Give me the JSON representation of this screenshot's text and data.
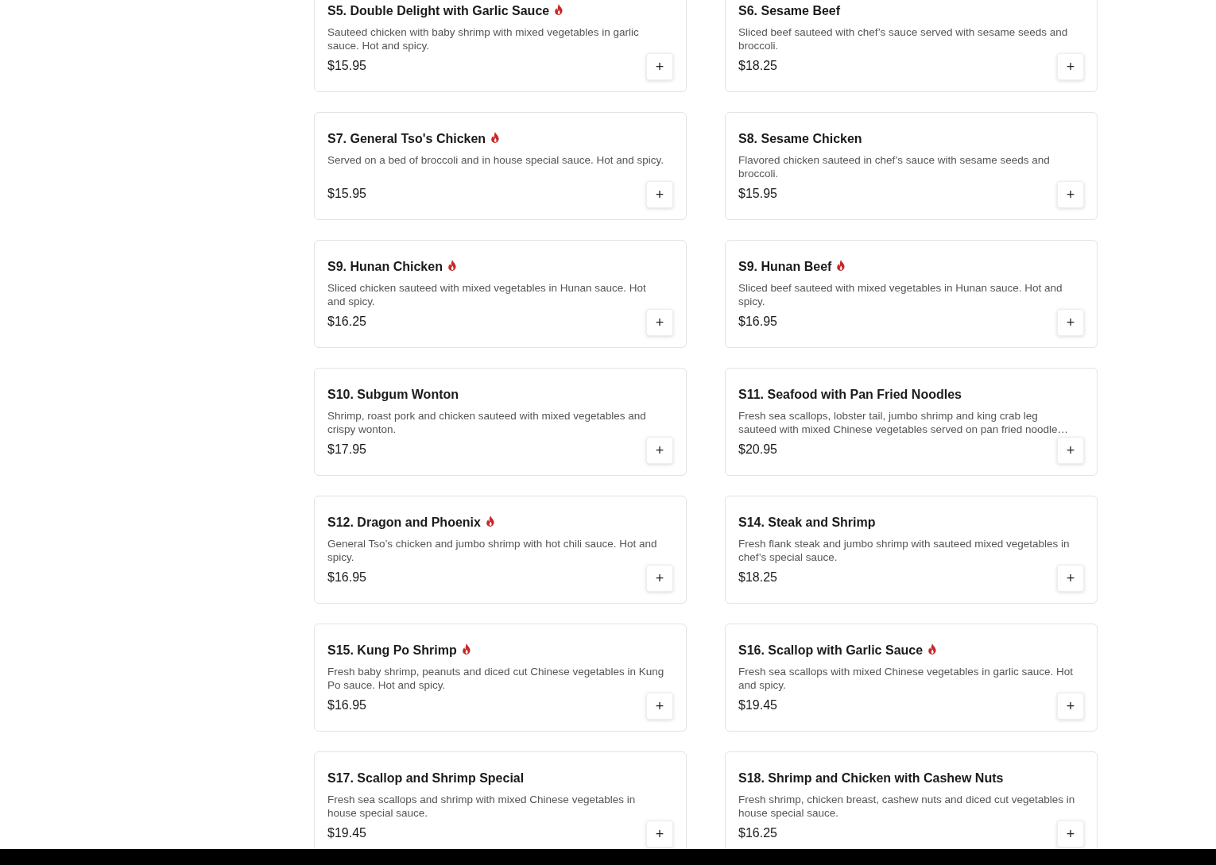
{
  "menu_items": [
    {
      "name": "S5. Double Delight with Garlic Sauce",
      "spicy": true,
      "description": "Sauteed chicken with baby shrimp with mixed vegetables in garlic sauce. Hot and spicy.",
      "price": "$15.95",
      "add_button": "+"
    },
    {
      "name": "S6. Sesame Beef",
      "spicy": false,
      "description": "Sliced beef sauteed with chef’s sauce served with sesame seeds and broccoli.",
      "price": "$18.25",
      "add_button": "+"
    },
    {
      "name": "S7. General Tso's Chicken",
      "spicy": true,
      "description": "Served on a bed of broccoli and in house special sauce. Hot and spicy.",
      "price": "$15.95",
      "add_button": "+"
    },
    {
      "name": "S8. Sesame Chicken",
      "spicy": false,
      "description": "Flavored chicken sauteed in chef’s sauce with sesame seeds and broccoli.",
      "price": "$15.95",
      "add_button": "+"
    },
    {
      "name": "S9. Hunan Chicken",
      "spicy": true,
      "description": "Sliced chicken sauteed with mixed vegetables in Hunan sauce. Hot and spicy.",
      "price": "$16.25",
      "add_button": "+"
    },
    {
      "name": "S9. Hunan Beef",
      "spicy": true,
      "description": "Sliced beef sauteed with mixed vegetables in Hunan sauce. Hot and spicy.",
      "price": "$16.95",
      "add_button": "+"
    },
    {
      "name": "S10. Subgum Wonton",
      "spicy": false,
      "description": "Shrimp, roast pork and chicken sauteed with mixed vegetables and crispy wonton.",
      "price": "$17.95",
      "add_button": "+"
    },
    {
      "name": "S11. Seafood with Pan Fried Noodles",
      "spicy": false,
      "description": "Fresh sea scallops, lobster tail, jumbo shrimp and king crab leg sauteed with mixed Chinese vegetables served on pan fried noodle…",
      "price": "$20.95",
      "add_button": "+"
    },
    {
      "name": "S12. Dragon and Phoenix",
      "spicy": true,
      "description": "General Tso’s chicken and jumbo shrimp with hot chili sauce. Hot and spicy.",
      "price": "$16.95",
      "add_button": "+"
    },
    {
      "name": "S14. Steak and Shrimp",
      "spicy": false,
      "description": "Fresh flank steak and jumbo shrimp with sauteed mixed vegetables in chef’s special sauce.",
      "price": "$18.25",
      "add_button": "+"
    },
    {
      "name": "S15. Kung Po Shrimp",
      "spicy": true,
      "description": "Fresh baby shrimp, peanuts and diced cut Chinese vegetables in Kung Po sauce. Hot and spicy.",
      "price": "$16.95",
      "add_button": "+"
    },
    {
      "name": "S16. Scallop with Garlic Sauce",
      "spicy": true,
      "description": "Fresh sea scallops with mixed Chinese vegetables in garlic sauce. Hot and spicy.",
      "price": "$19.45",
      "add_button": "+"
    },
    {
      "name": "S17. Scallop and Shrimp Special",
      "spicy": false,
      "description": "Fresh sea scallops and shrimp with mixed Chinese vegetables in house special sauce.",
      "price": "$19.45",
      "add_button": "+"
    },
    {
      "name": "S18. Shrimp and Chicken with Cashew Nuts",
      "spicy": false,
      "description": "Fresh shrimp, chicken breast, cashew nuts and diced cut vegetables in house special sauce.",
      "price": "$16.25",
      "add_button": "+"
    }
  ]
}
